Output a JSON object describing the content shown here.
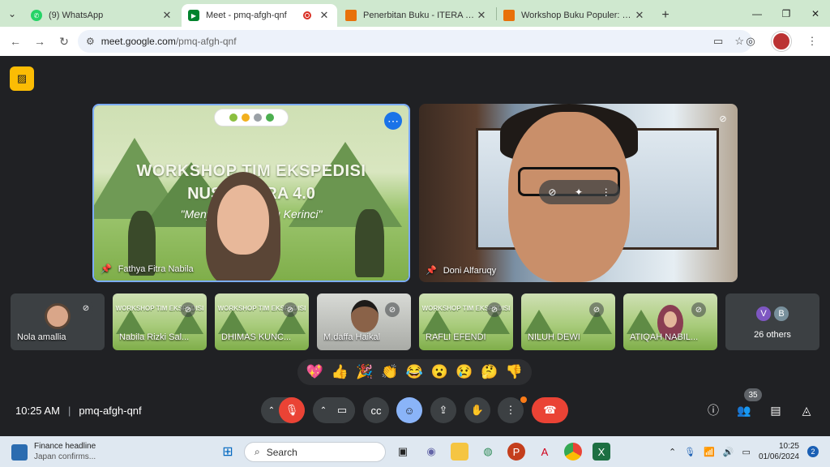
{
  "browser": {
    "tabs": [
      {
        "title": "(9) WhatsApp",
        "favicon_color": "#25d366"
      },
      {
        "title": "Meet - pmq-afgh-qnf",
        "favicon_color": "#00832d",
        "active": true
      },
      {
        "title": "Penerbitan Buku - ITERA Press",
        "favicon_color": "#e8710a"
      },
      {
        "title": "Workshop Buku Populer: Mena",
        "favicon_color": "#e8710a"
      }
    ],
    "url_host": "meet.google.com",
    "url_path": "/pmq-afgh-qnf"
  },
  "meet": {
    "main_tiles": [
      {
        "name": "Fathya Fitra Nabila"
      },
      {
        "name": "Doni Alfaruqy"
      }
    ],
    "slide": {
      "title_line1": "WORKSHOP TIM EKSPEDISI",
      "title_line2": "NUSANTARA 4.0",
      "quote": "\"Menyusuri Gunung Kerinci\""
    },
    "strip": [
      {
        "name": "Nola amallia"
      },
      {
        "name": "Nabila Rizki Sal..."
      },
      {
        "name": "DHIMAS KUNC..."
      },
      {
        "name": "M.daffa Haikal"
      },
      {
        "name": "RAFLI EFENDI"
      },
      {
        "name": "NILUH DEWI"
      },
      {
        "name": "ATIQAH NABIL..."
      }
    ],
    "others": {
      "label": "26 others",
      "avatars": [
        {
          "letter": "V",
          "color": "#7e57c2"
        },
        {
          "letter": "B",
          "color": "#78909c"
        }
      ]
    },
    "reactions": [
      "💖",
      "👍",
      "🎉",
      "👏",
      "😂",
      "😮",
      "😢",
      "🤔",
      "👎"
    ],
    "time": "10:25 AM",
    "meeting_code": "pmq-afgh-qnf",
    "participant_count": "35"
  },
  "taskbar": {
    "weather_title": "Finance headline",
    "weather_sub": "Japan confirms...",
    "search_placeholder": "Search",
    "clock_time": "10:25",
    "clock_date": "01/06/2024",
    "notification_count": "2"
  },
  "colors": {
    "meet_bg": "#202124",
    "accent_blue": "#8ab4f8",
    "danger_red": "#ea4335",
    "tab_strip": "#cfe8cf"
  }
}
